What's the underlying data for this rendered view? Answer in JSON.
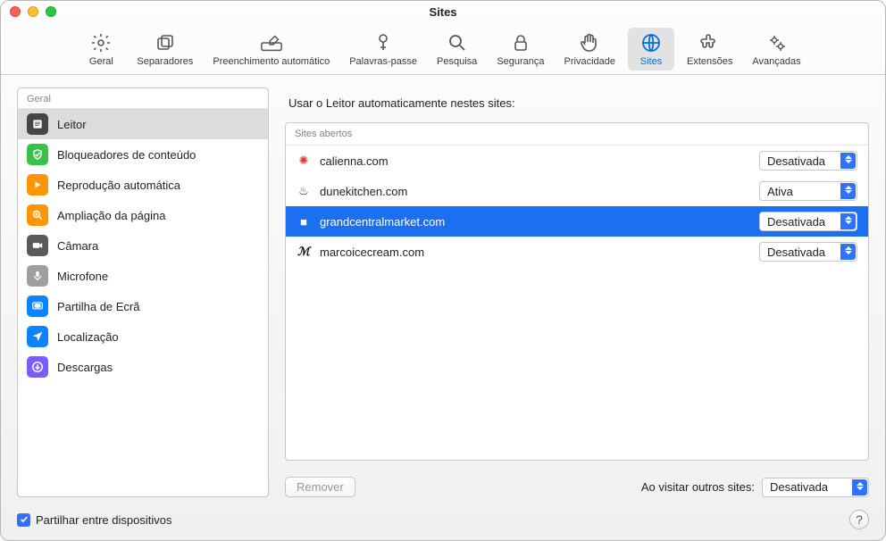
{
  "window": {
    "title": "Sites"
  },
  "toolbar": {
    "items": [
      {
        "label": "Geral"
      },
      {
        "label": "Separadores"
      },
      {
        "label": "Preenchimento automático"
      },
      {
        "label": "Palavras-passe"
      },
      {
        "label": "Pesquisa"
      },
      {
        "label": "Segurança"
      },
      {
        "label": "Privacidade"
      },
      {
        "label": "Sites"
      },
      {
        "label": "Extensões"
      },
      {
        "label": "Avançadas"
      }
    ],
    "active_index": 7
  },
  "sidebar": {
    "header": "Geral",
    "items": [
      {
        "label": "Leitor",
        "bg": "#464646"
      },
      {
        "label": "Bloqueadores de conteúdo",
        "bg": "#39c24a"
      },
      {
        "label": "Reprodução automática",
        "bg": "#ff9500"
      },
      {
        "label": "Ampliação da página",
        "bg": "#ff9500"
      },
      {
        "label": "Câmara",
        "bg": "#5a5a5a"
      },
      {
        "label": "Microfone",
        "bg": "#9f9f9f"
      },
      {
        "label": "Partilha de Ecrã",
        "bg": "#0a84ff"
      },
      {
        "label": "Localização",
        "bg": "#0a84ff"
      },
      {
        "label": "Descargas",
        "bg": "#7c5cff"
      }
    ],
    "selected_index": 0
  },
  "main": {
    "heading": "Usar o Leitor automaticamente nestes sites:",
    "table_header": "Sites abertos",
    "options": {
      "on": "Ativa",
      "off": "Desativada"
    },
    "rows": [
      {
        "site": "calienna.com",
        "value": "Desativada",
        "fav_color": "#d33",
        "fav_glyph": "✺"
      },
      {
        "site": "dunekitchen.com",
        "value": "Ativa",
        "fav_color": "#333",
        "fav_glyph": "♨"
      },
      {
        "site": "grandcentralmarket.com",
        "value": "Desativada",
        "fav_color": "#0a3",
        "fav_glyph": "■"
      },
      {
        "site": "marcoicecream.com",
        "value": "Desativada",
        "fav_color": "#111",
        "fav_glyph": "ℳ"
      }
    ],
    "selected_row": 2,
    "remove_label": "Remover",
    "other_sites_label": "Ao visitar outros sites:",
    "other_sites_value": "Desativada"
  },
  "bottom": {
    "share_label": "Partilhar entre dispositivos",
    "share_checked": true,
    "help_glyph": "?"
  }
}
